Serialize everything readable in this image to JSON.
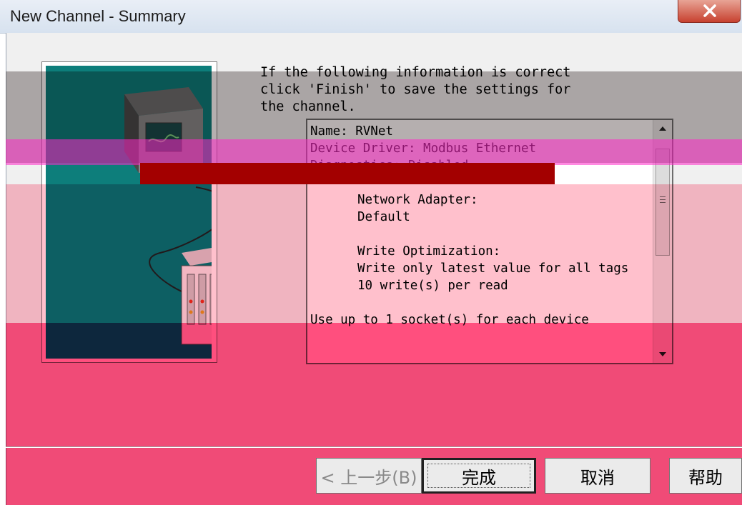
{
  "window": {
    "title": "New Channel - Summary"
  },
  "intro": {
    "text": "If the following information is correct\nclick 'Finish' to save the settings for\nthe channel."
  },
  "summary": {
    "lines": [
      {
        "text": "Name: RVNet",
        "indent": false
      },
      {
        "text": "Device Driver: Modbus Ethernet",
        "indent": false
      },
      {
        "text": "Diagnostics: Disabled",
        "indent": false
      },
      {
        "text": "",
        "indent": false
      },
      {
        "text": "Network Adapter:",
        "indent": true
      },
      {
        "text": "Default",
        "indent": true
      },
      {
        "text": "",
        "indent": true
      },
      {
        "text": "Write Optimization:",
        "indent": true
      },
      {
        "text": "Write only latest value for all tags",
        "indent": true
      },
      {
        "text": "10 write(s) per read",
        "indent": true
      },
      {
        "text": "",
        "indent": true
      },
      {
        "text": "Use up to 1 socket(s) for each device",
        "indent": false
      }
    ]
  },
  "buttons": {
    "back": "< 上一步(B)",
    "finish": "完成",
    "cancel": "取消",
    "help": "帮助"
  },
  "colors": {
    "teal": "#0d7e7b",
    "glitch_pink": "#ff1f5a",
    "glitch_dark_red": "#a30000"
  }
}
